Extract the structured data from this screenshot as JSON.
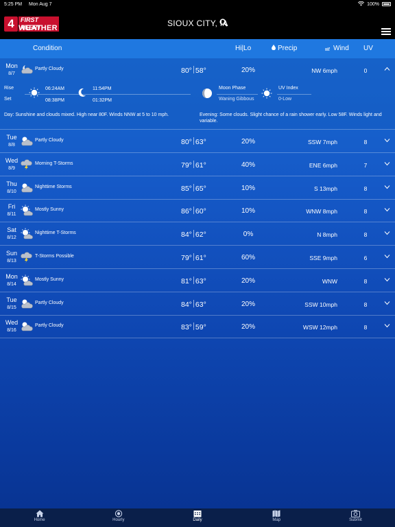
{
  "status": {
    "time": "5:25 PM",
    "date": "Mon Aug 7",
    "battery": "100%"
  },
  "header": {
    "logo_number": "4",
    "logo_line1": "FIRST ALERT",
    "logo_line2": "WEATHER",
    "city": "SIOUX CITY, IA"
  },
  "columns": {
    "condition": "Condition",
    "hilo": "Hi|Lo",
    "precip": "Precip",
    "wind": "Wind",
    "uv": "UV"
  },
  "expanded": {
    "rise_label": "Rise",
    "set_label": "Set",
    "sunrise": "06:24AM",
    "sunset": "08:38PM",
    "moonrise": "11:54PM",
    "moonset": "01:32PM",
    "moon_phase_label": "Moon Phase",
    "moon_phase": "Waning Gibbous",
    "uv_label": "UV Index",
    "uv_value": "0-Low",
    "day_text": "Day: Sunshine and clouds mixed. High near 80F. Winds NNW at 5 to 10 mph.",
    "evening_text": "Evening: Some clouds. Slight chance of a rain shower early. Low 58F. Winds light and variable."
  },
  "days": [
    {
      "day": "Mon",
      "date": "8/7",
      "condition": "Partly Cloudy",
      "icon": "partly-cloudy-night-icon",
      "hi": "80°",
      "lo": "58°",
      "precip": "20%",
      "wind": "NW 6mph",
      "uv": "0"
    },
    {
      "day": "Tue",
      "date": "8/8",
      "condition": "Partly Cloudy",
      "icon": "partly-cloudy-icon",
      "hi": "80°",
      "lo": "63°",
      "precip": "20%",
      "wind": "SSW 7mph",
      "uv": "8"
    },
    {
      "day": "Wed",
      "date": "8/9",
      "condition": "Morning T-Storms",
      "icon": "thunderstorm-icon",
      "hi": "79°",
      "lo": "61°",
      "precip": "40%",
      "wind": "ENE 6mph",
      "uv": "7"
    },
    {
      "day": "Thu",
      "date": "8/10",
      "condition": "Nighttime Storms",
      "icon": "partly-cloudy-icon",
      "hi": "85°",
      "lo": "65°",
      "precip": "10%",
      "wind": "S 13mph",
      "uv": "8"
    },
    {
      "day": "Fri",
      "date": "8/11",
      "condition": "Mostly Sunny",
      "icon": "mostly-sunny-icon",
      "hi": "86°",
      "lo": "60°",
      "precip": "10%",
      "wind": "WNW 8mph",
      "uv": "8"
    },
    {
      "day": "Sat",
      "date": "8/12",
      "condition": "Nighttime T-Storms",
      "icon": "mostly-sunny-icon",
      "hi": "84°",
      "lo": "62°",
      "precip": "0%",
      "wind": "N 8mph",
      "uv": "8"
    },
    {
      "day": "Sun",
      "date": "8/13",
      "condition": "T-Storms Possible",
      "icon": "thunderstorm-icon",
      "hi": "79°",
      "lo": "61°",
      "precip": "60%",
      "wind": "SSE 9mph",
      "uv": "6"
    },
    {
      "day": "Mon",
      "date": "8/14",
      "condition": "Mostly Sunny",
      "icon": "mostly-sunny-icon",
      "hi": "81°",
      "lo": "63°",
      "precip": "20%",
      "wind": "WNW",
      "uv": "8"
    },
    {
      "day": "Tue",
      "date": "8/15",
      "condition": "Partly Cloudy",
      "icon": "partly-cloudy-icon",
      "hi": "84°",
      "lo": "63°",
      "precip": "20%",
      "wind": "SSW 10mph",
      "uv": "8"
    },
    {
      "day": "Wed",
      "date": "8/16",
      "condition": "Partly Cloudy",
      "icon": "partly-cloudy-icon",
      "hi": "83°",
      "lo": "59°",
      "precip": "20%",
      "wind": "WSW 12mph",
      "uv": "8"
    }
  ],
  "nav": [
    {
      "label": "Home",
      "icon": "home-icon"
    },
    {
      "label": "Hourly",
      "icon": "clock-icon"
    },
    {
      "label": "Daily",
      "icon": "calendar-icon"
    },
    {
      "label": "Map",
      "icon": "map-icon"
    },
    {
      "label": "Submit",
      "icon": "camera-icon"
    }
  ]
}
